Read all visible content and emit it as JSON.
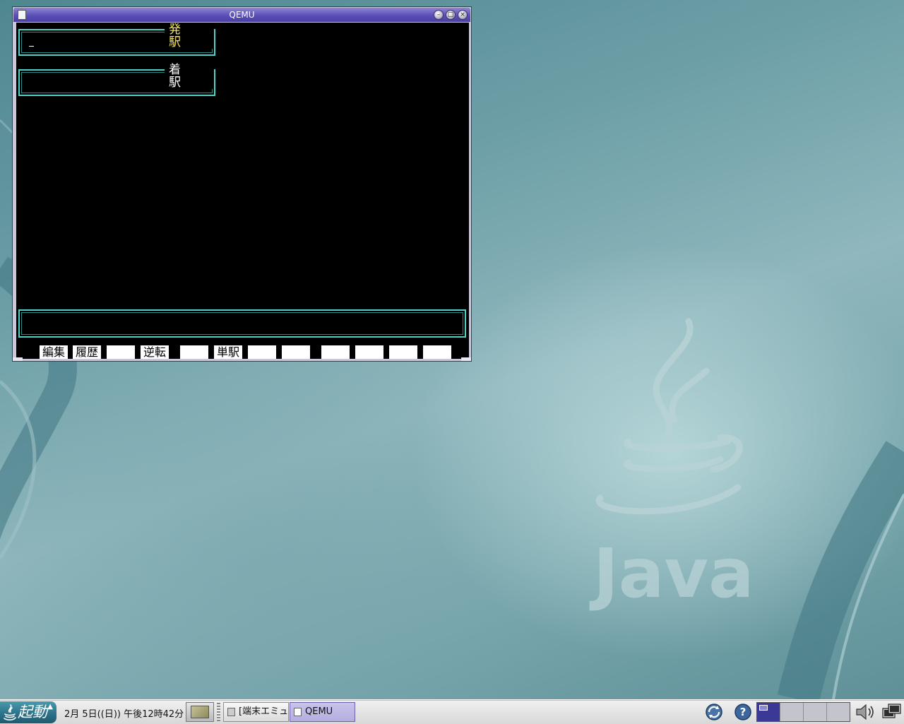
{
  "window": {
    "title": "QEMU",
    "departure_label": "発 駅",
    "arrival_label": "着 駅",
    "departure_value": "",
    "arrival_value": "",
    "message": "",
    "function_keys": [
      "編集",
      "履歴",
      "",
      "逆転",
      "",
      "単駅",
      "",
      "",
      "",
      "",
      "",
      ""
    ]
  },
  "taskbar": {
    "start_label": "起動",
    "clock": "2月 5日((日)) 午後12時42分",
    "tasks": [
      {
        "label": "[端末エミュレ",
        "active": false
      },
      {
        "label": "QEMU",
        "active": true
      }
    ],
    "workspaces": 4,
    "active_workspace": 1
  },
  "desktop": {
    "wallpaper_logo_text": "Java"
  },
  "colors": {
    "title_bar": "#5a4fb6",
    "field_border": "#4fd3c8",
    "departure_label": "#f2e25a",
    "start_button": "#2a6f86"
  },
  "icons": [
    "window-menu-icon",
    "minimize-icon",
    "maximize-icon",
    "close-icon",
    "java-start-icon",
    "show-desktop-icon",
    "update-icon",
    "help-icon",
    "volume-icon",
    "network-icon"
  ]
}
